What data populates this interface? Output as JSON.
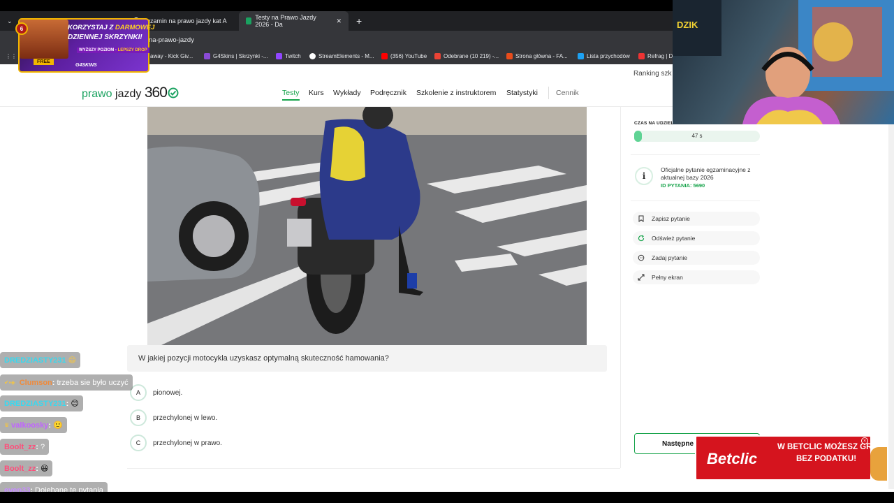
{
  "browser": {
    "tabs": [
      {
        "label": "",
        "active": false
      },
      {
        "label": "egzamin na prawo jazdy kat A",
        "active": false
      },
      {
        "label": "Testy na Prawo Jazdy 2026 - Da",
        "active": true
      }
    ],
    "new_tab_symbol": "+",
    "url": "na-prawo-jazdy",
    "bookmarks": [
      {
        "label": "away - Kick Giv...",
        "color": "#53fc18"
      },
      {
        "label": "G4Skins | Skrzynki -...",
        "color": "#8a4bd6"
      },
      {
        "label": "Twitch",
        "color": "#9146ff"
      },
      {
        "label": "StreamElements - M...",
        "color": "#ffffff"
      },
      {
        "label": "(356) YouTube",
        "color": "#ff0000"
      },
      {
        "label": "Odebrane (10 219) -...",
        "color": "#ea4335"
      },
      {
        "label": "Strona główna - FA...",
        "color": "#e84c1b"
      },
      {
        "label": "Lista przychodów",
        "color": "#1da1f2"
      },
      {
        "label": "Refrag | D",
        "color": "#e33"
      }
    ]
  },
  "header": {
    "ranking": "Ranking szk",
    "logo_a": "prawo",
    "logo_b": "jazdy",
    "logo_c": "360",
    "nav": [
      "Testy",
      "Kurs",
      "Wykłady",
      "Podręcznik",
      "Szkolenie z instruktorem",
      "Statystyki",
      "Cennik"
    ]
  },
  "question": {
    "text": "W jakiej pozycji motocykla uzyskasz optymalną skuteczność hamowania?",
    "options": [
      {
        "letter": "A",
        "text": "pionowej."
      },
      {
        "letter": "B",
        "text": "przechylonej w lewo."
      },
      {
        "letter": "C",
        "text": "przechylonej w prawo."
      }
    ],
    "next_label": "Następne"
  },
  "sidebar": {
    "time_label": "CZAS NA UDZIEL",
    "time_value": "47 s",
    "time_progress": 0.06,
    "info_icon": "i",
    "info_line1": "Oficjalne pytanie egzaminacyjne z aktualnej bazy 2026",
    "info_id": "ID PYTANIA: 5690",
    "actions": [
      {
        "label": "Zapisz pytanie",
        "icon": "bookmark-icon"
      },
      {
        "label": "Odśwież pytanie",
        "icon": "refresh-icon"
      },
      {
        "label": "Zadaj pytanie",
        "icon": "chat-icon"
      },
      {
        "label": "Pełny ekran",
        "icon": "expand-icon"
      }
    ]
  },
  "overlay": {
    "promo": {
      "badge": "6",
      "line1a": "KORZYSTAJ Z ",
      "line1b": "DARMOWEJ",
      "line2": "DZIENNEJ SKRZYNKI!",
      "line3a": "WYŻSZY POZIOM - ",
      "line3b": "LEPSZY DROP",
      "free": "FREE",
      "brand": "G4SKINS"
    },
    "chat": [
      {
        "user": "DREDZIASTY231",
        "msg": "",
        "color": "#37d9f0"
      },
      {
        "user": "Clumson",
        "msg": "trzeba sie było uczyć",
        "color": "#f08a3a"
      },
      {
        "user": "DREDZIASTY231",
        "msg": "",
        "color": "#37d9f0"
      },
      {
        "user": "valkoosky",
        "msg": "",
        "color": "#c063ff"
      },
      {
        "user": "Boolt_zz",
        "msg": "?",
        "color": "#ff4d7a"
      },
      {
        "user": "Boolt_zz",
        "msg": "",
        "color": "#ff4d7a"
      },
      {
        "user": "even33",
        "msg": "Dojebane te pytania",
        "color": "#c58cff"
      }
    ],
    "betclic": {
      "logo": "Betclic",
      "line1": "W BETCLIC MOŻESZ GRAĆ",
      "line2": "BEZ PODATKU!",
      "close": "×"
    },
    "webcam_sign": "DZIK"
  },
  "colors": {
    "accent": "#16a34a",
    "betclic": "#d5141e",
    "promo": "#5d1fa0"
  }
}
